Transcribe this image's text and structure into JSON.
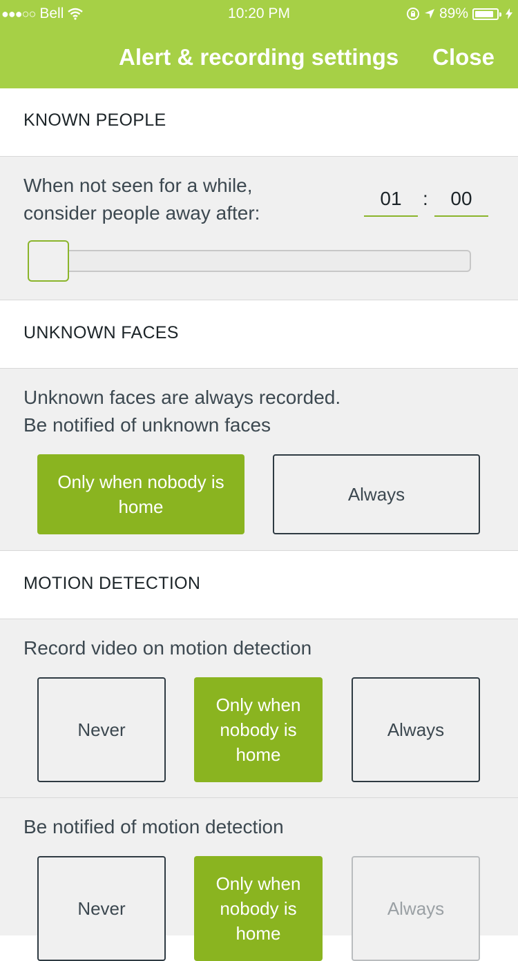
{
  "status_bar": {
    "carrier": "Bell",
    "time": "10:20 PM",
    "battery": "89%",
    "battery_level_percent": 89
  },
  "header": {
    "title": "Alert & recording settings",
    "close_label": "Close"
  },
  "known_people": {
    "heading": "KNOWN PEOPLE",
    "description_line1": "When not seen for a while,",
    "description_line2": "consider people away after:",
    "hours": "01",
    "separator": ":",
    "minutes": "00",
    "slider_value_fraction": 0
  },
  "unknown_faces": {
    "heading": "UNKNOWN FACES",
    "description_line1": "Unknown faces are always recorded.",
    "description_line2": "Be notified of unknown faces",
    "options": [
      {
        "label": "Only when nobody is home",
        "selected": true
      },
      {
        "label": "Always",
        "selected": false
      }
    ]
  },
  "motion_detection": {
    "heading": "MOTION DETECTION",
    "record": {
      "description": "Record video on motion detection",
      "options": [
        {
          "label": "Never",
          "selected": false
        },
        {
          "label": "Only when nobody is home",
          "selected": true
        },
        {
          "label": "Always",
          "selected": false
        }
      ]
    },
    "notify": {
      "description": "Be notified of motion detection",
      "options": [
        {
          "label": "Never",
          "selected": false
        },
        {
          "label": "Only when nobody is home",
          "selected": true
        },
        {
          "label": "Always",
          "selected": false,
          "disabled": true
        }
      ]
    }
  },
  "colors": {
    "header_green": "#a6d046",
    "selected_green": "#8ab420",
    "panel_gray": "#f0f0f0"
  },
  "icons": [
    "signal-dots-icon",
    "wifi-icon",
    "rotation-lock-icon",
    "location-arrow-icon",
    "battery-icon",
    "charging-bolt-icon"
  ]
}
